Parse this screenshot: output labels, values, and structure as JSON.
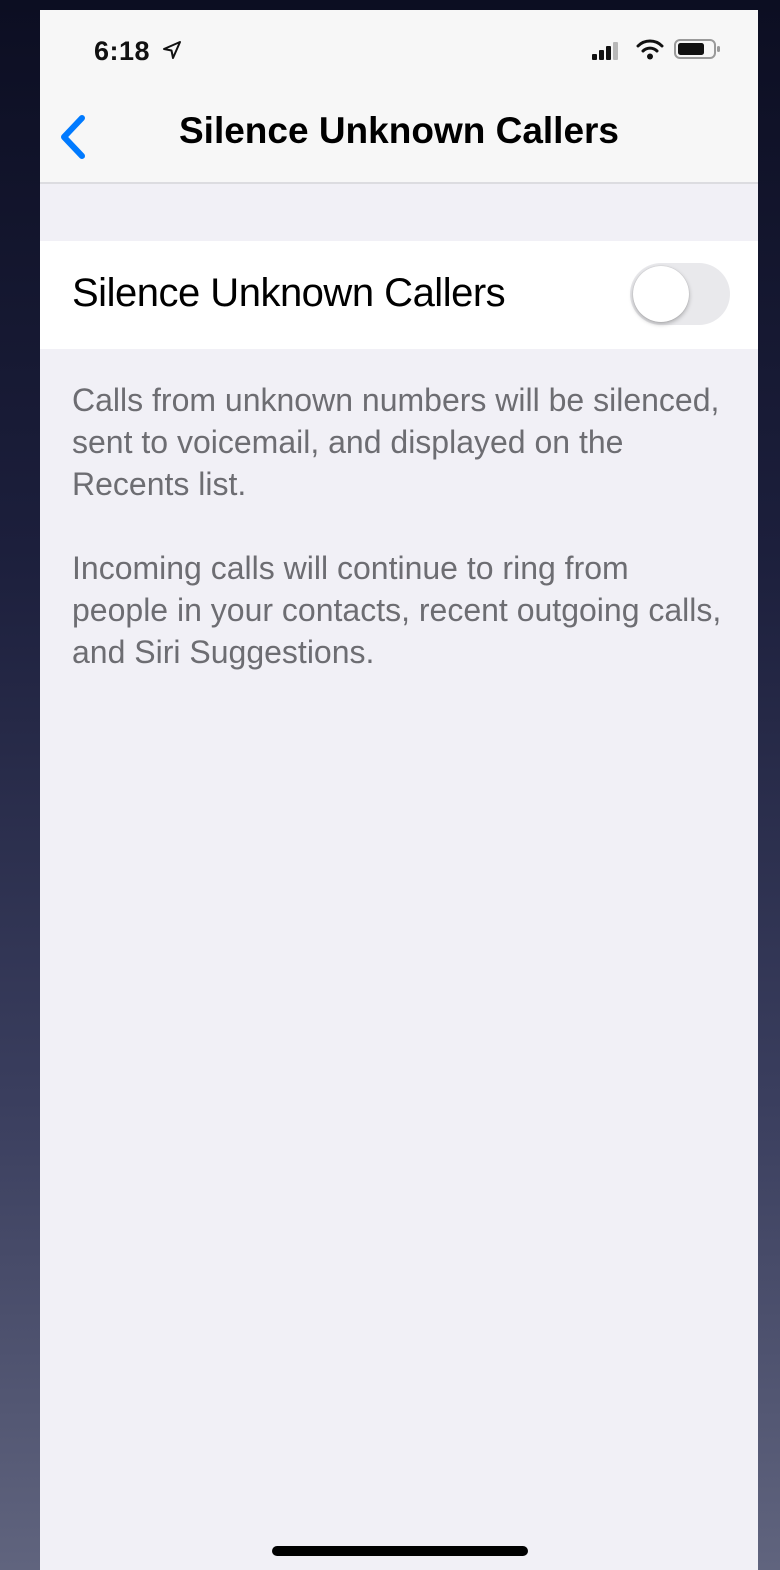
{
  "status_bar": {
    "time": "6:18",
    "icons": [
      "location-arrow-icon",
      "cellular-signal-icon",
      "wifi-icon",
      "battery-icon"
    ]
  },
  "nav": {
    "back_icon": "chevron-left-icon",
    "title": "Silence Unknown Callers"
  },
  "setting": {
    "label": "Silence Unknown Callers",
    "toggle_state": "off"
  },
  "footer": {
    "paragraph_1": "Calls from unknown numbers will be silenced, sent to voicemail, and displayed on the Recents list.",
    "paragraph_2": "Incoming calls will continue to ring from people in your contacts, recent outgoing calls, and Siri Suggestions."
  },
  "colors": {
    "accent": "#007aff",
    "grouped_background": "#f1f0f6",
    "cell_background": "#ffffff",
    "footer_text": "#6d6d72",
    "toggle_off": "#e9e9ec"
  }
}
